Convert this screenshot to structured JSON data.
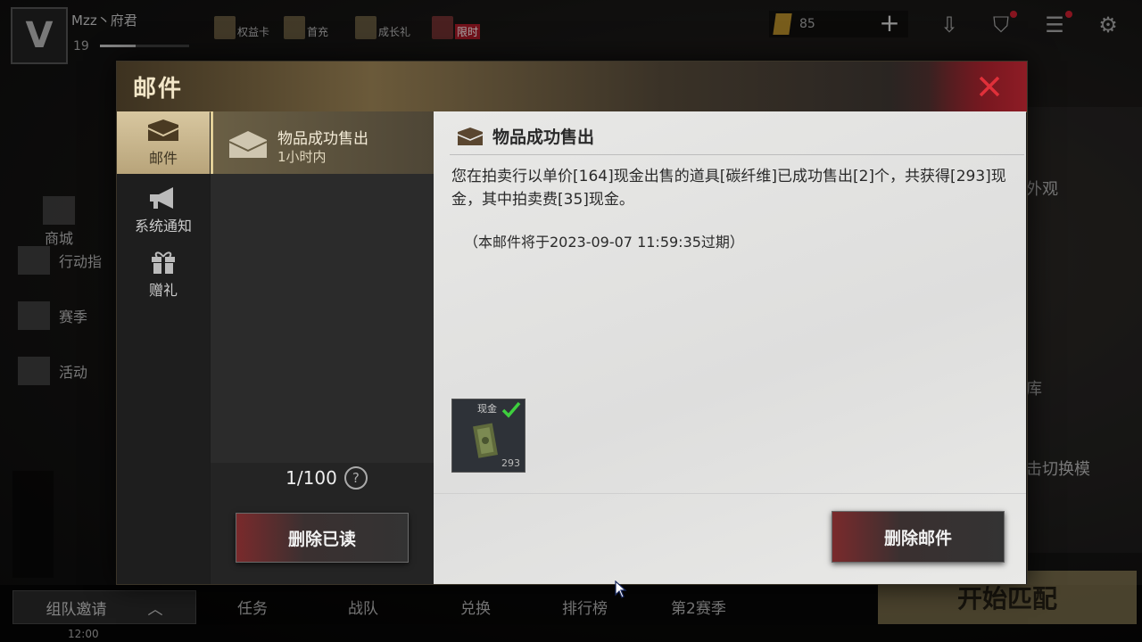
{
  "lobby": {
    "player_name": "Mzz丶府君",
    "player_level": "19",
    "top_items": [
      "权益卡",
      "首充",
      "成长礼"
    ],
    "limited_tag": "限时",
    "currency_amount": "85",
    "left_menu": [
      "商城",
      "行动指",
      "赛季",
      "活动"
    ],
    "team_invite": "组队邀请",
    "nav": [
      "任务",
      "战队",
      "兑换",
      "排行榜",
      "第2赛季"
    ],
    "start_match": "开始匹配",
    "clock": "12:00",
    "right_texts": [
      "外观",
      "库",
      "击切换模"
    ]
  },
  "mail_dialog": {
    "title": "邮件",
    "categories": [
      {
        "label": "邮件",
        "icon": "envelope-icon",
        "active": true
      },
      {
        "label": "系统通知",
        "icon": "megaphone-icon",
        "active": false
      },
      {
        "label": "赠礼",
        "icon": "gift-icon",
        "active": false
      }
    ],
    "mail_list": [
      {
        "subject": "物品成功售出",
        "time": "1小时内",
        "icon": "open-envelope-icon"
      }
    ],
    "page_count": "1/100",
    "delete_read_label": "删除已读",
    "detail": {
      "title": "物品成功售出",
      "body": "您在拍卖行以单价[164]现金出售的道具[碳纤维]已成功售出[2]个，共获得[293]现金，其中拍卖费[35]现金。",
      "expire_note": "（本邮件将于2023-09-07 11:59:35过期）",
      "attachment": {
        "name": "现金",
        "quantity": "293",
        "claimed": true
      },
      "delete_label": "删除邮件"
    }
  },
  "colors": {
    "accent_gold": "#d8c7a0",
    "close_red": "#e0303a",
    "claimed_green": "#3ecf3e"
  }
}
